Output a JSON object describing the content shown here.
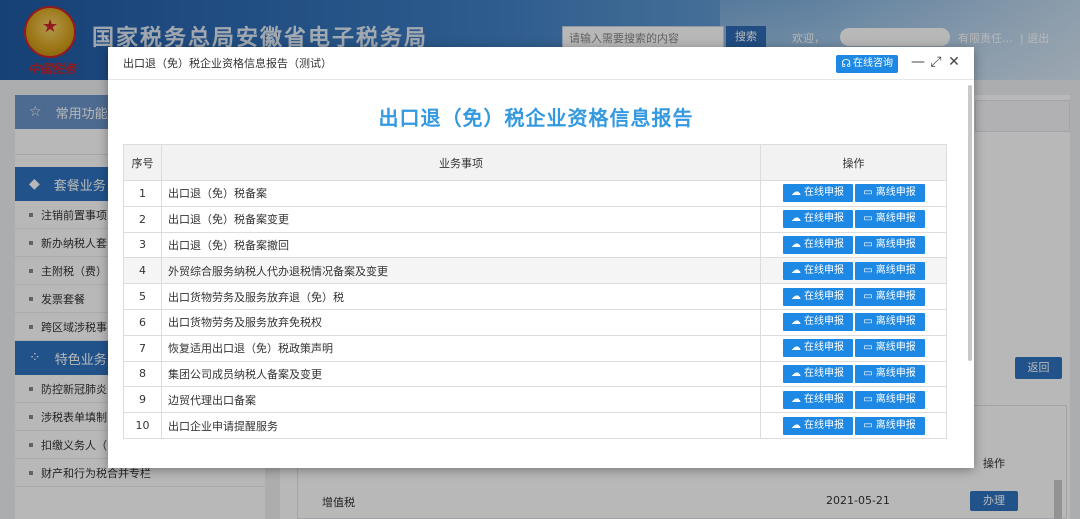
{
  "header": {
    "site_title": "国家税务总局安徽省电子税务局",
    "calligraphy": "中国税务",
    "search_placeholder": "请输入需要搜索的内容",
    "search_button": "搜索",
    "user_prefix": "欢迎，",
    "user_suffix": "有限责任...",
    "logout": "退出"
  },
  "sidebar": {
    "favorites": "常用功能",
    "package_header": "套餐业务",
    "package_items": [
      "注销前置事项",
      "新办纳税人套",
      "主附税（费）",
      "发票套餐",
      "跨区域涉税事"
    ],
    "special_header": "特色业务",
    "special_items": [
      "防控新冠肺炎",
      "涉税表单填制",
      "扣缴义务人（",
      "财产和行为税合并专栏"
    ]
  },
  "background": {
    "back_button": "返回",
    "op_header": "操作",
    "row_tax": "增值税",
    "row_date": "2021-05-21",
    "row_button": "办理"
  },
  "modal": {
    "window_title": "出口退（免）税企业资格信息报告（测试）",
    "consult_button": "在线咨询",
    "report_title": "出口退（免）税企业资格信息报告",
    "columns": [
      "序号",
      "业务事项",
      "操作"
    ],
    "online_label": "在线申报",
    "offline_label": "离线申报",
    "rows": [
      {
        "no": "1",
        "item": "出口退（免）税备案"
      },
      {
        "no": "2",
        "item": "出口退（免）税备案变更"
      },
      {
        "no": "3",
        "item": "出口退（免）税备案撤回"
      },
      {
        "no": "4",
        "item": "外贸综合服务纳税人代办退税情况备案及变更"
      },
      {
        "no": "5",
        "item": "出口货物劳务及服务放弃退（免）税"
      },
      {
        "no": "6",
        "item": "出口货物劳务及服务放弃免税权"
      },
      {
        "no": "7",
        "item": "恢复适用出口退（免）税政策声明"
      },
      {
        "no": "8",
        "item": "集团公司成员纳税人备案及变更"
      },
      {
        "no": "9",
        "item": "边贸代理出口备案"
      },
      {
        "no": "10",
        "item": "出口企业申请提醒服务"
      }
    ]
  },
  "colors": {
    "accent": "#1e88e5",
    "title_blue": "#3399e0",
    "sidebar_blue": "#2f74c0"
  }
}
